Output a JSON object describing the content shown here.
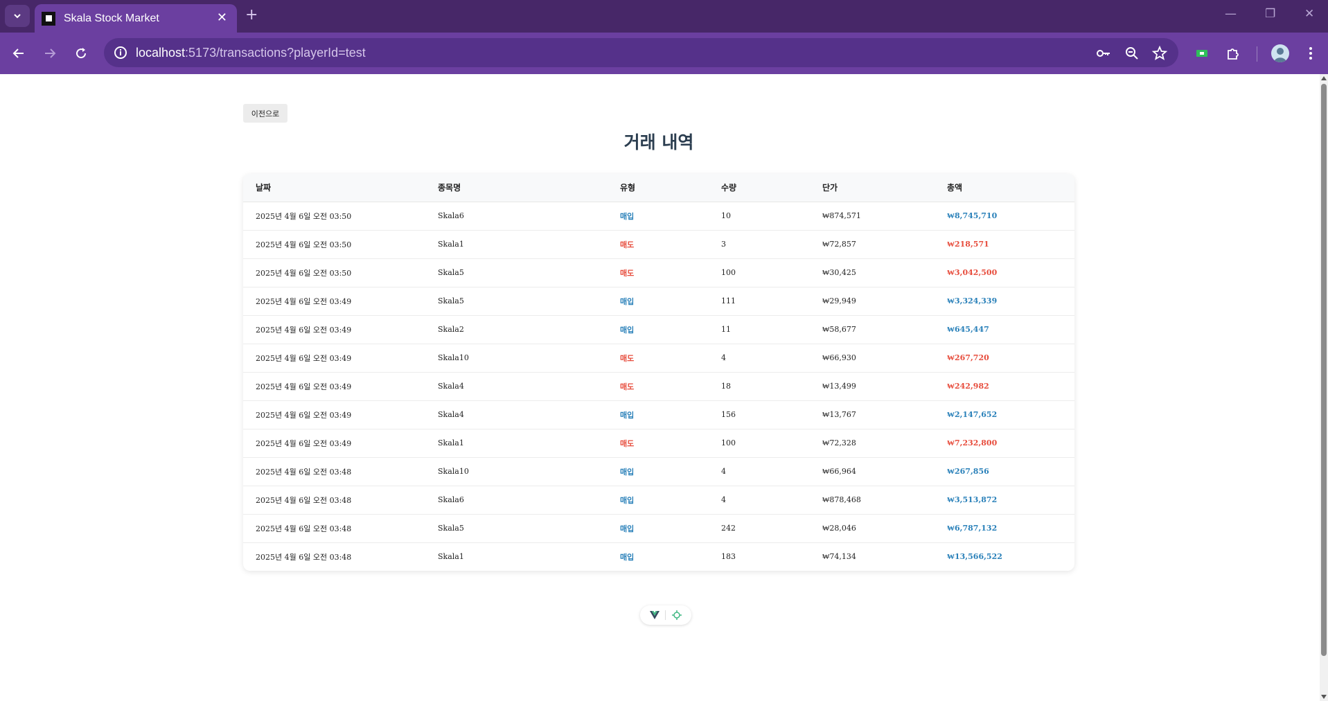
{
  "browser": {
    "tab_title": "Skala Stock Market",
    "url_host": "localhost",
    "url_rest": ":5173/transactions?playerId=test"
  },
  "page": {
    "back_label": "이전으로",
    "title": "거래 내역"
  },
  "table": {
    "headers": [
      "날짜",
      "종목명",
      "유형",
      "수량",
      "단가",
      "총액"
    ],
    "rows": [
      {
        "date": "2025년 4월 6일 오전 03:50",
        "name": "Skala6",
        "type": "매입",
        "qty": "10",
        "price": "₩874,571",
        "total": "₩8,745,710",
        "kind": "buy"
      },
      {
        "date": "2025년 4월 6일 오전 03:50",
        "name": "Skala1",
        "type": "매도",
        "qty": "3",
        "price": "₩72,857",
        "total": "₩218,571",
        "kind": "sell"
      },
      {
        "date": "2025년 4월 6일 오전 03:50",
        "name": "Skala5",
        "type": "매도",
        "qty": "100",
        "price": "₩30,425",
        "total": "₩3,042,500",
        "kind": "sell"
      },
      {
        "date": "2025년 4월 6일 오전 03:49",
        "name": "Skala5",
        "type": "매입",
        "qty": "111",
        "price": "₩29,949",
        "total": "₩3,324,339",
        "kind": "buy"
      },
      {
        "date": "2025년 4월 6일 오전 03:49",
        "name": "Skala2",
        "type": "매입",
        "qty": "11",
        "price": "₩58,677",
        "total": "₩645,447",
        "kind": "buy"
      },
      {
        "date": "2025년 4월 6일 오전 03:49",
        "name": "Skala10",
        "type": "매도",
        "qty": "4",
        "price": "₩66,930",
        "total": "₩267,720",
        "kind": "sell"
      },
      {
        "date": "2025년 4월 6일 오전 03:49",
        "name": "Skala4",
        "type": "매도",
        "qty": "18",
        "price": "₩13,499",
        "total": "₩242,982",
        "kind": "sell"
      },
      {
        "date": "2025년 4월 6일 오전 03:49",
        "name": "Skala4",
        "type": "매입",
        "qty": "156",
        "price": "₩13,767",
        "total": "₩2,147,652",
        "kind": "buy"
      },
      {
        "date": "2025년 4월 6일 오전 03:49",
        "name": "Skala1",
        "type": "매도",
        "qty": "100",
        "price": "₩72,328",
        "total": "₩7,232,800",
        "kind": "sell"
      },
      {
        "date": "2025년 4월 6일 오전 03:48",
        "name": "Skala10",
        "type": "매입",
        "qty": "4",
        "price": "₩66,964",
        "total": "₩267,856",
        "kind": "buy"
      },
      {
        "date": "2025년 4월 6일 오전 03:48",
        "name": "Skala6",
        "type": "매입",
        "qty": "4",
        "price": "₩878,468",
        "total": "₩3,513,872",
        "kind": "buy"
      },
      {
        "date": "2025년 4월 6일 오전 03:48",
        "name": "Skala5",
        "type": "매입",
        "qty": "242",
        "price": "₩28,046",
        "total": "₩6,787,132",
        "kind": "buy"
      },
      {
        "date": "2025년 4월 6일 오전 03:48",
        "name": "Skala1",
        "type": "매입",
        "qty": "183",
        "price": "₩74,134",
        "total": "₩13,566,522",
        "kind": "buy"
      }
    ]
  },
  "colors": {
    "buy": "#2980b9",
    "sell": "#e74c3c",
    "title": "#2c3e50",
    "chrome_dark": "#472768",
    "chrome": "#6b3fa0"
  },
  "icons": {
    "tab_menu": "chevron-down-icon",
    "close_tab": "close-icon",
    "new_tab": "plus-icon",
    "back": "arrow-left-icon",
    "forward": "arrow-right-icon",
    "reload": "reload-icon",
    "site_info": "info-icon",
    "passwords": "key-icon",
    "zoom": "zoom-out-icon",
    "bookmark": "star-icon",
    "extensions": "puzzle-icon",
    "menu": "kebab-menu-icon"
  }
}
